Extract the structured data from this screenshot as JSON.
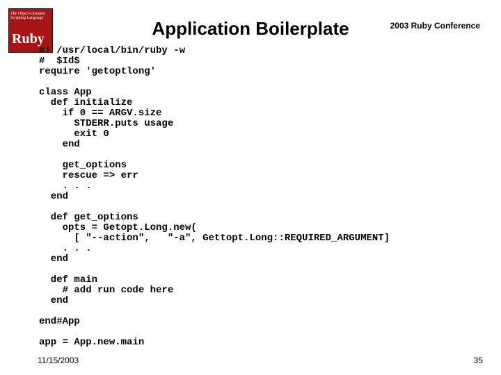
{
  "logo": {
    "subtitle": "The Object-Oriented\nScripting Language",
    "main": "Ruby"
  },
  "header": {
    "title": "Application Boilerplate",
    "conference": "2003 Ruby Conference"
  },
  "code": "#! /usr/local/bin/ruby -w\n#  $Id$\nrequire 'getoptlong'\n\nclass App\n  def initialize\n    if 0 == ARGV.size\n      STDERR.puts usage\n      exit 0\n    end\n\n    get_options\n    rescue => err\n    . . .\n  end\n\n  def get_options\n    opts = Getopt.Long.new(\n      [ \"--action\",   \"-a\", Gettopt.Long::REQUIRED_ARGUMENT]\n    . . .\n  end\n\n  def main\n    # add run code here\n  end\n\nend#App\n\napp = App.new.main",
  "footer": {
    "date": "11/15/2003",
    "page": "35"
  }
}
